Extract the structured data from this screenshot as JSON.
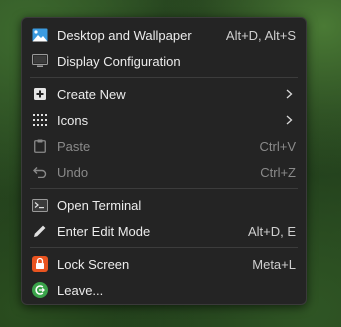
{
  "menu": {
    "items": [
      {
        "label": "Desktop and Wallpaper",
        "shortcut": "Alt+D, Alt+S",
        "icon": "desktop-wallpaper-icon",
        "disabled": false
      },
      {
        "label": "Display Configuration",
        "shortcut": "",
        "icon": "display-icon",
        "disabled": false
      },
      {
        "label": "Create New",
        "shortcut": "",
        "icon": "create-new-icon",
        "submenu": true,
        "disabled": false
      },
      {
        "label": "Icons",
        "shortcut": "",
        "icon": "icons-grid-icon",
        "submenu": true,
        "disabled": false
      },
      {
        "label": "Paste",
        "shortcut": "Ctrl+V",
        "icon": "clipboard-icon",
        "disabled": true
      },
      {
        "label": "Undo",
        "shortcut": "Ctrl+Z",
        "icon": "undo-icon",
        "disabled": true
      },
      {
        "label": "Open Terminal",
        "shortcut": "",
        "icon": "terminal-icon",
        "disabled": false
      },
      {
        "label": "Enter Edit Mode",
        "shortcut": "Alt+D, E",
        "icon": "pencil-icon",
        "disabled": false
      },
      {
        "label": "Lock Screen",
        "shortcut": "Meta+L",
        "icon": "lock-icon",
        "disabled": false
      },
      {
        "label": "Leave...",
        "shortcut": "",
        "icon": "leave-icon",
        "disabled": false
      }
    ]
  },
  "colors": {
    "menu_bg": "#242424",
    "text": "#ececec",
    "disabled_text": "#8a8a8a",
    "lock_orange": "#e95420",
    "leave_green": "#3aa34a",
    "wallpaper_blue": "#3b9be0"
  }
}
